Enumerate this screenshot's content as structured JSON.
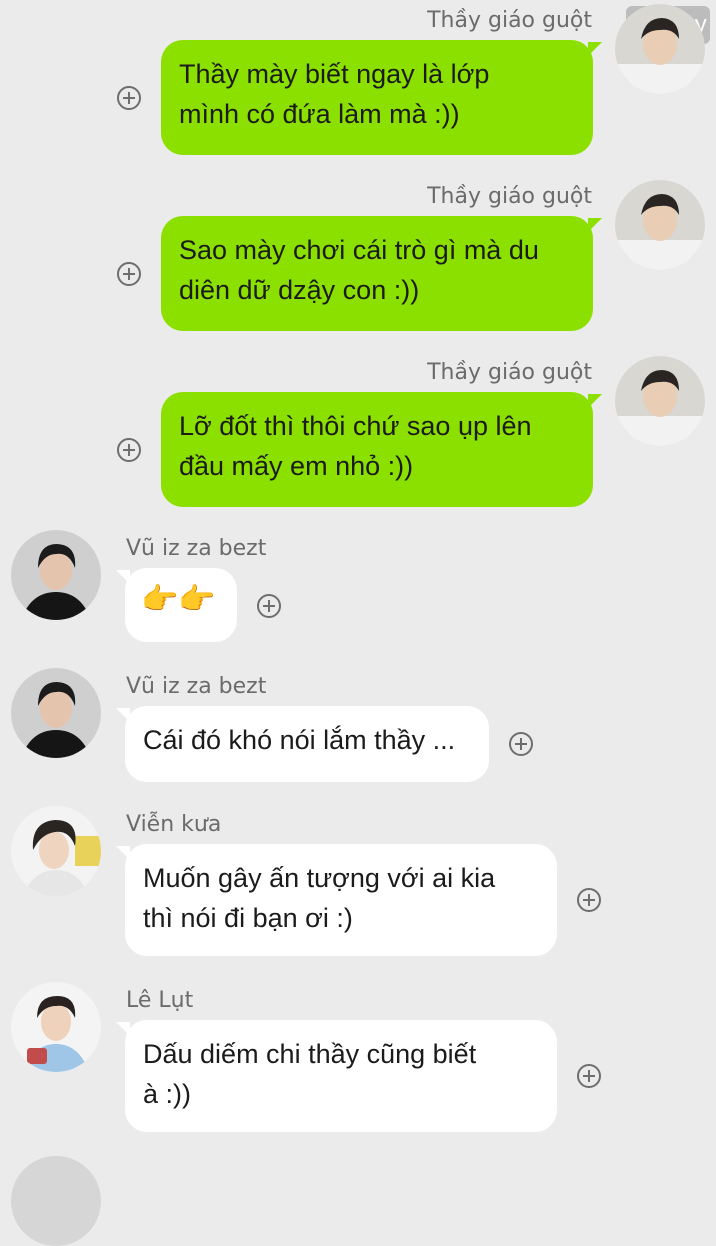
{
  "watermark": "131 joy",
  "colors": {
    "outgoing_bubble": "#8be000",
    "incoming_bubble": "#ffffff",
    "background": "#ebebeb"
  },
  "messages": [
    {
      "sender": "Thầy giáo guột",
      "side": "outgoing",
      "lines": [
        "Thầy mày biết ngay là lớp",
        "mình có đứa làm mà :))"
      ]
    },
    {
      "sender": "Thầy giáo guột",
      "side": "outgoing",
      "lines": [
        "Sao mày chơi cái trò gì mà du",
        "diên dữ dzậy con :))"
      ]
    },
    {
      "sender": "Thầy giáo guột",
      "side": "outgoing",
      "lines": [
        "Lỡ đốt thì thôi chứ sao ụp lên",
        "đầu mấy em nhỏ :))"
      ]
    },
    {
      "sender": "Vũ iz za bezt",
      "side": "incoming",
      "emoji": "👉👉"
    },
    {
      "sender": "Vũ iz za bezt",
      "side": "incoming",
      "lines": [
        "Cái đó khó nói lắm thầy ..."
      ]
    },
    {
      "sender": "Viễn kưa",
      "side": "incoming",
      "lines": [
        "Muốn gây ấn tượng với ai kia",
        "thì nói đi bạn ơi :)"
      ]
    },
    {
      "sender": "Lê Lụt",
      "side": "incoming",
      "lines": [
        "Dấu diếm chi thầy cũng biết",
        "à :))"
      ]
    }
  ],
  "icons": {
    "react": "add-reaction-icon",
    "avatar": "user-avatar"
  }
}
